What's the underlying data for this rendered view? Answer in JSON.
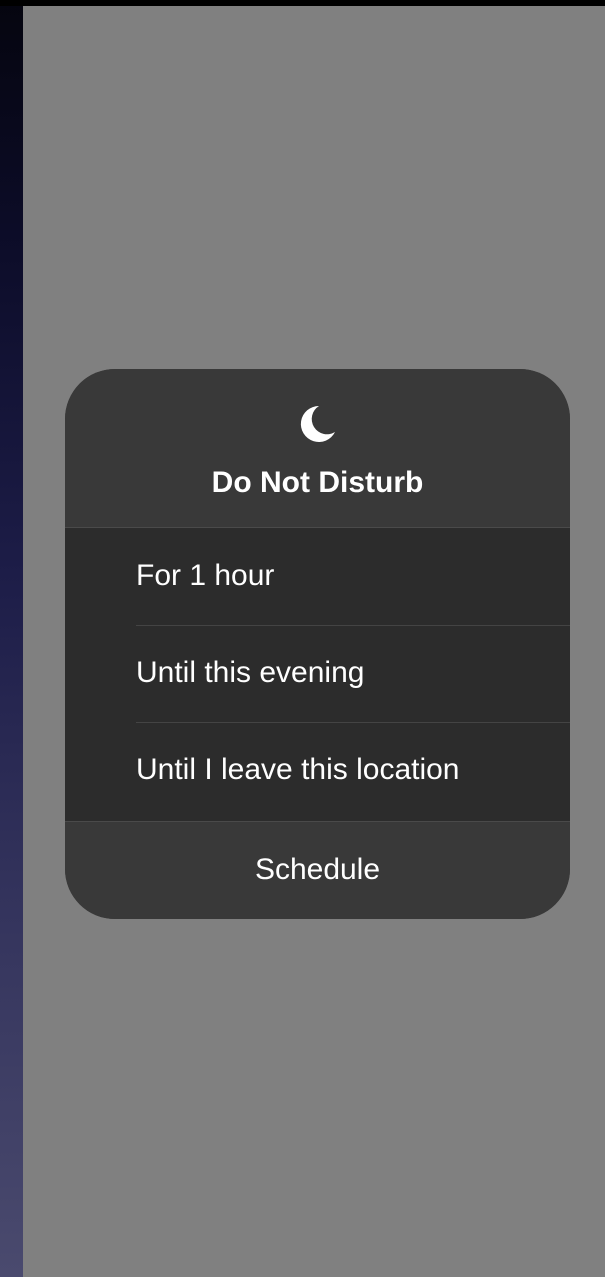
{
  "dnd_menu": {
    "title": "Do Not Disturb",
    "icon": "moon-icon",
    "options": [
      {
        "label": "For 1 hour"
      },
      {
        "label": "Until this evening"
      },
      {
        "label": "Until I leave this location"
      }
    ],
    "footer_label": "Schedule"
  },
  "colors": {
    "overlay": "#808080",
    "menu_header": "#393939",
    "menu_options": "#2c2c2c",
    "text": "#ffffff"
  }
}
